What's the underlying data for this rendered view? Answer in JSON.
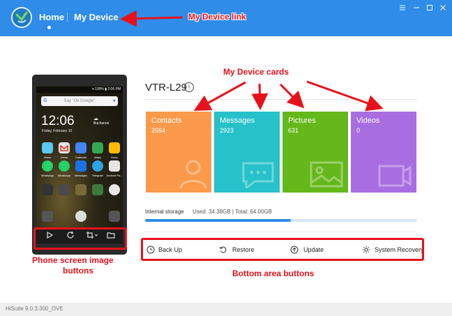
{
  "header": {
    "home_label": "Home",
    "device_label": "My Device",
    "menu_icon": "menu-icon",
    "minimize_icon": "minimize-icon",
    "maximize_icon": "maximize-icon",
    "close_icon": "close-icon"
  },
  "phone": {
    "status_text": "▾ 100% ▮ 2:06 PM",
    "search_placeholder": "Say \"Ok Google\"",
    "clock": "12:06",
    "clock_sub": "Friday, February 10",
    "weather_city": "Bucharest",
    "weather_temp": "",
    "apps_row1": [
      "Waze",
      "Gmail",
      "Calendar",
      "Maps",
      "Keep"
    ],
    "apps_row2": [
      "WhatsApp",
      "WhatsApp",
      "Messages",
      "Telegram",
      "Android Pa..."
    ],
    "controls": [
      "play-icon",
      "refresh-icon",
      "crop-icon",
      "folder-icon"
    ]
  },
  "device": {
    "title": "VTR-L29",
    "info_icon": "info-icon"
  },
  "cards": [
    {
      "title": "Contacts",
      "count": "2664",
      "color": "#fb9a4a"
    },
    {
      "title": "Messages",
      "count": "2923",
      "color": "#26c1c9"
    },
    {
      "title": "Pictures",
      "count": "631",
      "color": "#64b81a"
    },
    {
      "title": "Videos",
      "count": "0",
      "color": "#a86de0"
    }
  ],
  "storage": {
    "label": "Internal storage",
    "value_text": "Used: 34.38GB | Total: 64.00GB",
    "used_fraction": 0.537
  },
  "bottom_buttons": [
    {
      "label": "Back Up",
      "icon": "backup-icon"
    },
    {
      "label": "Restore",
      "icon": "restore-icon"
    },
    {
      "label": "Update",
      "icon": "update-icon"
    },
    {
      "label": "System Recovery",
      "icon": "gear-icon"
    }
  ],
  "footer": {
    "version": "HiSuite 9.0.3.300_OVE"
  },
  "annotations": {
    "device_link": "My Device link",
    "device_cards": "My Device cards",
    "phone_buttons_line1": "Phone screen image",
    "phone_buttons_line2": "buttons",
    "bottom_buttons": "Bottom area buttons",
    "color": "#e8111b"
  }
}
